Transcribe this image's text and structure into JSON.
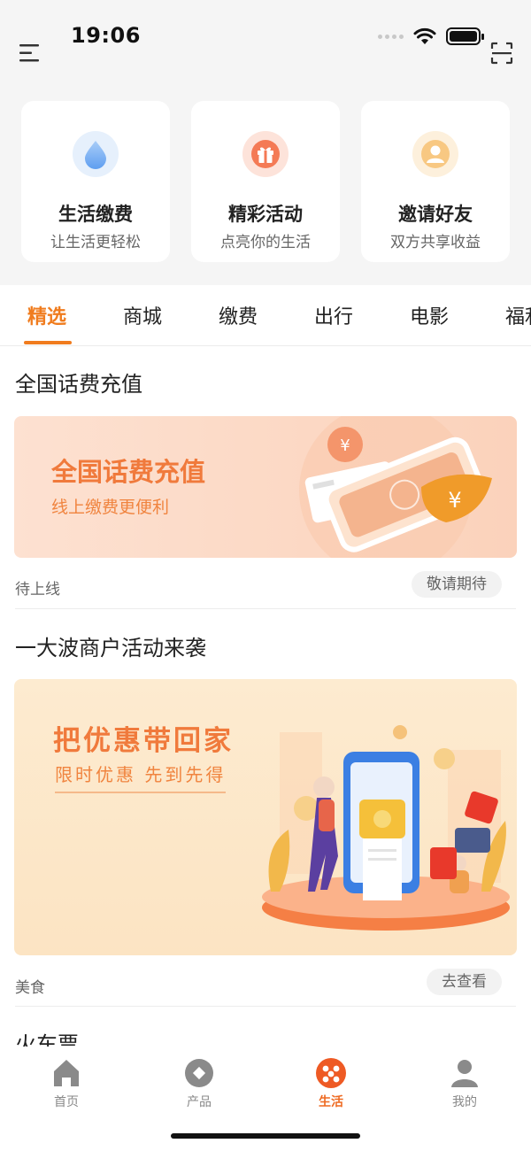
{
  "status_bar": {
    "time": "19:06"
  },
  "quick_cards": [
    {
      "title": "生活缴费",
      "subtitle": "让生活更轻松",
      "icon": "water-drop-icon"
    },
    {
      "title": "精彩活动",
      "subtitle": "点亮你的生活",
      "icon": "gift-icon"
    },
    {
      "title": "邀请好友",
      "subtitle": "双方共享收益",
      "icon": "user-icon"
    }
  ],
  "tabs": [
    "精选",
    "商城",
    "缴费",
    "出行",
    "电影",
    "福利"
  ],
  "active_tab": "精选",
  "sections": [
    {
      "title": "全国话费充值",
      "banner_title": "全国话费充值",
      "banner_subtitle": "线上缴费更便利",
      "tag": "待上线",
      "button": "敬请期待"
    },
    {
      "title": "一大波商户活动来袭",
      "banner_title": "把优惠带回家",
      "banner_subtitle": "限时优惠 先到先得",
      "tag": "美食",
      "button": "去查看"
    },
    {
      "title": "火车票"
    }
  ],
  "bottom_nav": [
    {
      "label": "首页",
      "icon": "home-icon"
    },
    {
      "label": "产品",
      "icon": "product-icon"
    },
    {
      "label": "生活",
      "icon": "life-icon"
    },
    {
      "label": "我的",
      "icon": "profile-icon"
    }
  ],
  "active_nav": "生活",
  "colors": {
    "accent": "#f07c1e",
    "banner_text": "#f07a3c",
    "background": "#f5f5f5"
  }
}
